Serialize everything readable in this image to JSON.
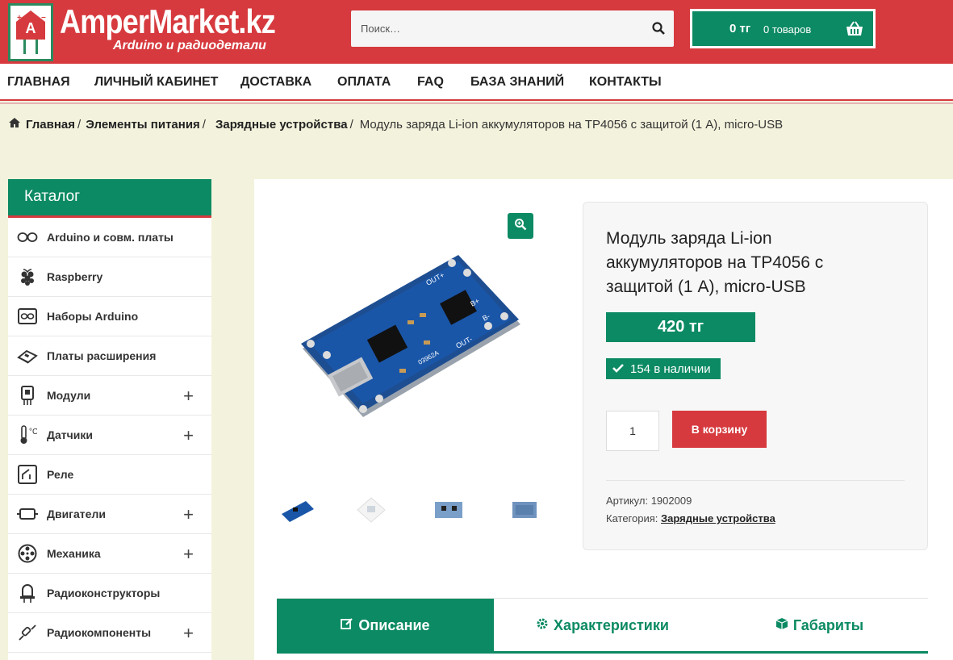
{
  "header": {
    "logo_title": "AmperMarket.kz",
    "logo_subtitle": "Arduino и радиодетали",
    "search_placeholder": "Поиск…",
    "cart_sum": "0 тг",
    "cart_count": "0 товаров"
  },
  "nav": {
    "items": [
      "ГЛАВНАЯ",
      "ЛИЧНЫЙ КАБИНЕТ",
      "ДОСТАВКА",
      "ОПЛАТА",
      "FAQ",
      "БАЗА ЗНАНИЙ",
      "КОНТАКТЫ"
    ]
  },
  "breadcrumb": {
    "items": [
      "Главная",
      "Элементы питания",
      "Зарядные устройства"
    ],
    "separator": "/",
    "current": "Модуль заряда Li-ion аккумуляторов на TP4056 с защитой (1 А), micro-USB"
  },
  "sidebar": {
    "title": "Каталог",
    "items": [
      {
        "label": "Arduino и совм. платы",
        "icon": "infinity-icon",
        "expandable": false
      },
      {
        "label": "Raspberry",
        "icon": "raspberry-icon",
        "expandable": false
      },
      {
        "label": "Наборы Arduino",
        "icon": "kit-icon",
        "expandable": false
      },
      {
        "label": "Платы расширения",
        "icon": "board-icon",
        "expandable": false
      },
      {
        "label": "Модули",
        "icon": "module-icon",
        "expandable": true
      },
      {
        "label": "Датчики",
        "icon": "thermometer-icon",
        "expandable": true
      },
      {
        "label": "Реле",
        "icon": "relay-icon",
        "expandable": false
      },
      {
        "label": "Двигатели",
        "icon": "motor-icon",
        "expandable": true
      },
      {
        "label": "Механика",
        "icon": "wheel-icon",
        "expandable": true
      },
      {
        "label": "Радиоконструкторы",
        "icon": "lamp-icon",
        "expandable": false
      },
      {
        "label": "Радиокомпоненты",
        "icon": "resistor-icon",
        "expandable": true
      }
    ],
    "plus": "+"
  },
  "product": {
    "title": "Модуль заряда Li-ion аккумуляторов на TP4056 с защитой (1 А), micro-USB",
    "price": "420 тг",
    "stock": "154 в наличии",
    "quantity": "1",
    "add_to_cart": "В корзину",
    "sku_label": "Артикул:",
    "sku": "1902009",
    "category_label": "Категория:",
    "category": "Зарядные устройства",
    "pcb_labels": {
      "out_plus": "OUT+",
      "b_plus": "B+",
      "b_minus": "B-",
      "out_minus": "OUT-",
      "chip": "03962A"
    }
  },
  "tabs": [
    {
      "label": "Описание",
      "icon": "edit-icon",
      "active": true
    },
    {
      "label": "Характеристики",
      "icon": "gear-icon",
      "active": false
    },
    {
      "label": "Габариты",
      "icon": "box-icon",
      "active": false
    }
  ],
  "colors": {
    "brand_red": "#d63a3e",
    "brand_green": "#0c8a63",
    "page_bg": "#f3f2dc"
  }
}
